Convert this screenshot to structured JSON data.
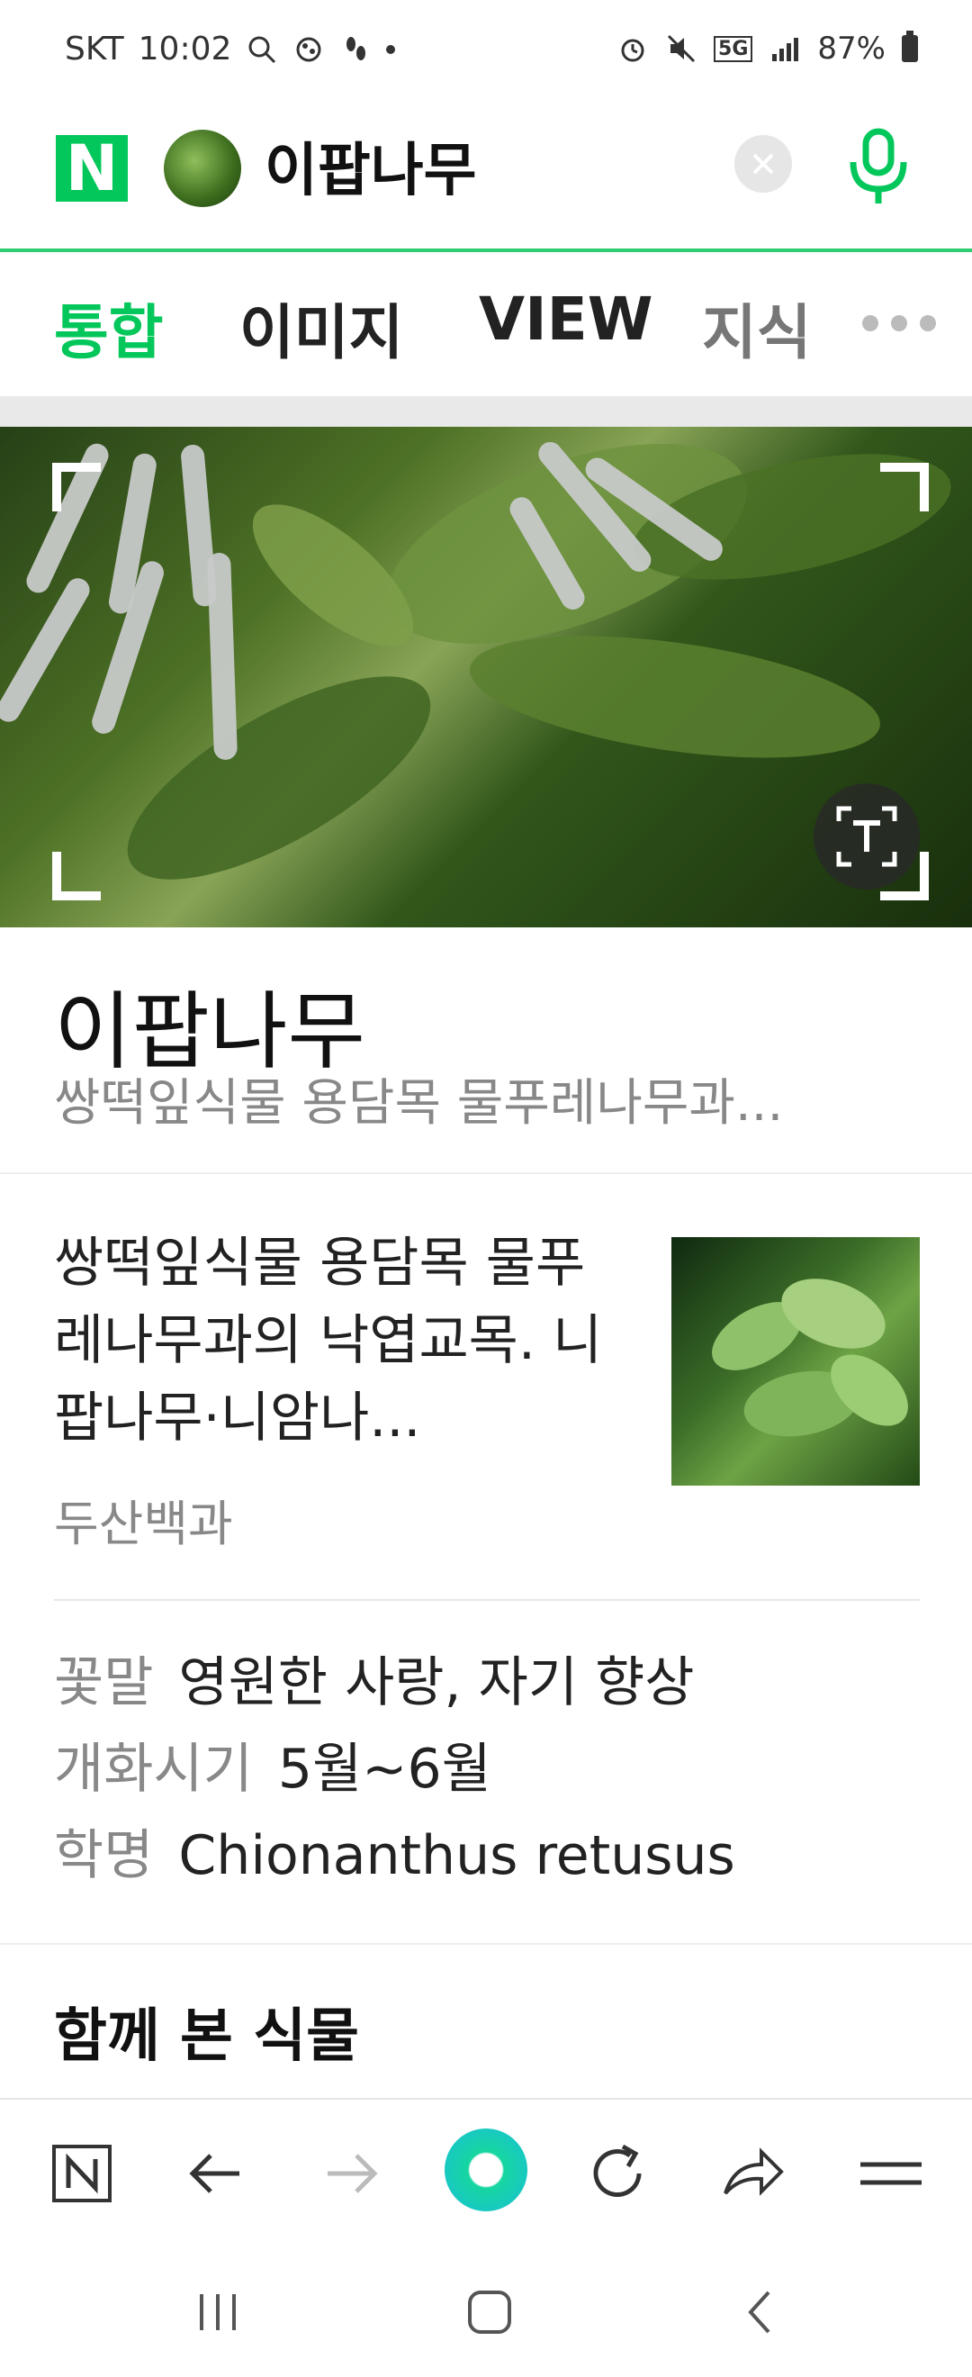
{
  "status_bar": {
    "carrier": "SKT",
    "time": "10:02",
    "battery": "87%",
    "network": "5G"
  },
  "search": {
    "logo": "N",
    "query": "이팝나무"
  },
  "tabs": [
    "통합",
    "이미지",
    "VIEW",
    "지식"
  ],
  "result": {
    "title": "이팝나무",
    "subtitle": "쌍떡잎식물 용담목 물푸레나무과...",
    "description": "쌍떡잎식물 용담목 물푸레나무과의 낙엽교목. 니팝나무·니암나...",
    "source": "두산백과",
    "info": [
      {
        "key": "꽃말",
        "value": "영원한 사랑, 자기 향상"
      },
      {
        "key": "개화시기",
        "value": "5월~6월"
      },
      {
        "key": "학명",
        "value": "Chionanthus retusus"
      }
    ],
    "related_heading": "함께 본 식물"
  },
  "colors": {
    "brand_green": "#03c75a",
    "accent_teal": "#18c9c1"
  },
  "icons": {
    "bottom_toolbar": [
      "naver-home-icon",
      "back-arrow-icon",
      "forward-arrow-icon",
      "green-home-button",
      "refresh-icon",
      "share-icon",
      "menu-icon"
    ],
    "system_nav": [
      "recents-icon",
      "home-icon",
      "back-icon"
    ]
  }
}
